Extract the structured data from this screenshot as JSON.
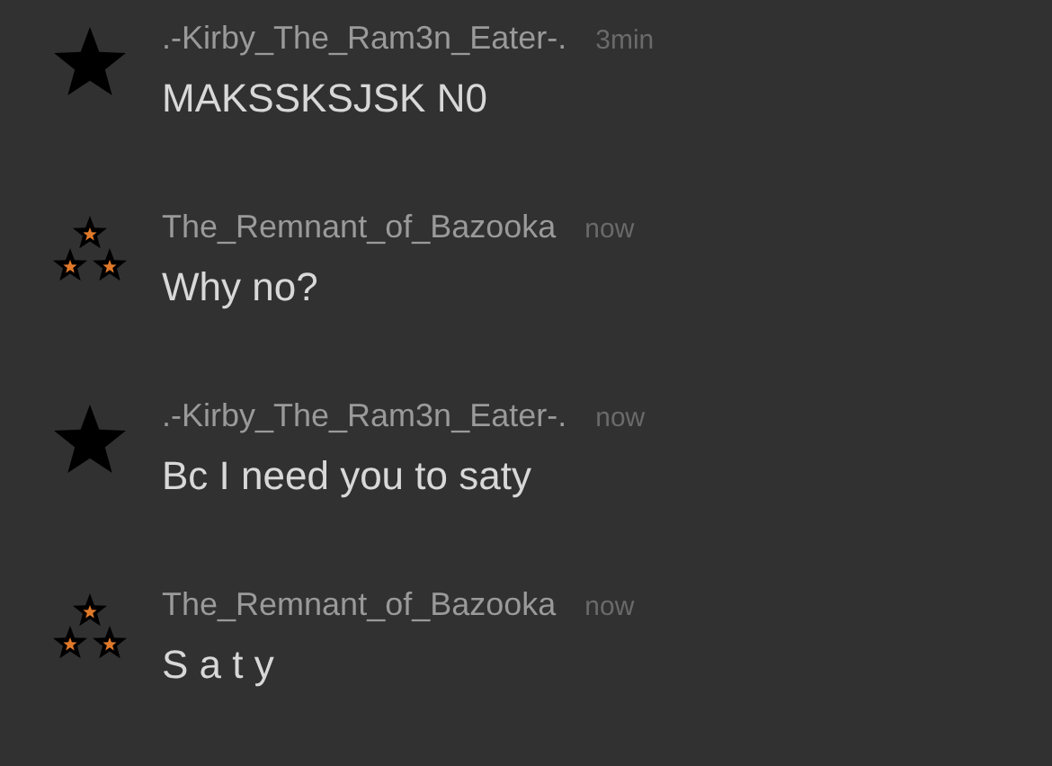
{
  "messages": [
    {
      "avatar": {
        "kind": "star"
      },
      "author": ".-Kirby_The_Ram3n_Eater-.",
      "time": "3min",
      "text": "MAKSSKSJSK N0"
    },
    {
      "avatar": {
        "kind": "triple-star"
      },
      "author": "The_Remnant_of_Bazooka",
      "time": "now",
      "text": "Why no?"
    },
    {
      "avatar": {
        "kind": "star"
      },
      "author": ".-Kirby_The_Ram3n_Eater-.",
      "time": "now",
      "text": "Bc I need you to saty"
    },
    {
      "avatar": {
        "kind": "triple-star"
      },
      "author": "The_Remnant_of_Bazooka",
      "time": "now",
      "text": "S a t y"
    }
  ]
}
